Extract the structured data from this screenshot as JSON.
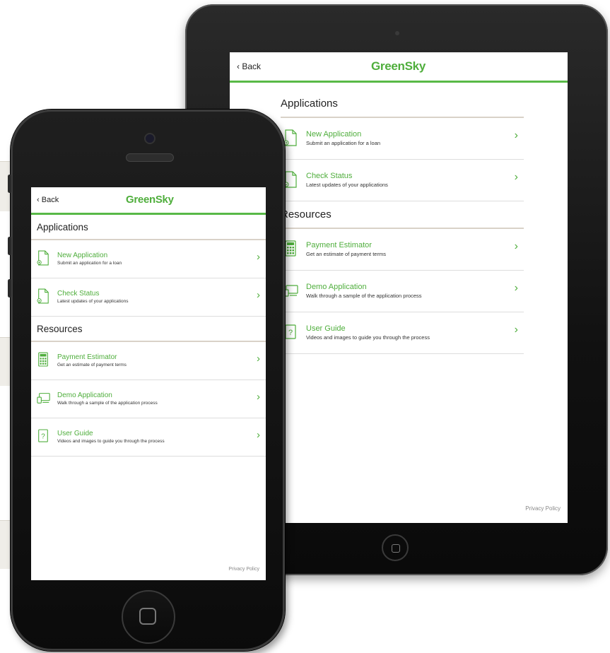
{
  "ipad": {
    "back_label": "Back",
    "logo": "GreenSky",
    "sections": [
      {
        "title": "Applications",
        "items": [
          {
            "title": "New Application",
            "subtitle": "Submit an application for a loan",
            "icon": "new-application-icon"
          },
          {
            "title": "Check Status",
            "subtitle": "Latest updates of your applications",
            "icon": "check-status-icon"
          }
        ]
      },
      {
        "title": "Resources",
        "items": [
          {
            "title": "Payment Estimator",
            "subtitle": "Get an estimate of payment terms",
            "icon": "calculator-icon"
          },
          {
            "title": "Demo Application",
            "subtitle": "Walk through a sample of the application process",
            "icon": "devices-icon"
          },
          {
            "title": "User Guide",
            "subtitle": "Videos and images to guide you through the process",
            "icon": "question-icon"
          }
        ]
      }
    ],
    "privacy": "Privacy Policy"
  },
  "iphone": {
    "back_label": "Back",
    "logo": "GreenSky",
    "sections": [
      {
        "title": "Applications",
        "items": [
          {
            "title": "New Application",
            "subtitle": "Submit an application for a loan",
            "icon": "new-application-icon"
          },
          {
            "title": "Check Status",
            "subtitle": "Latest updates of your applications",
            "icon": "check-status-icon"
          }
        ]
      },
      {
        "title": "Resources",
        "items": [
          {
            "title": "Payment Estimator",
            "subtitle": "Get an estimate of payment terms",
            "icon": "calculator-icon"
          },
          {
            "title": "Demo Application",
            "subtitle": "Walk through a sample of the application process",
            "icon": "devices-icon"
          },
          {
            "title": "User Guide",
            "subtitle": "Videos and images to guide you through the process",
            "icon": "question-icon"
          }
        ]
      }
    ],
    "privacy": "Privacy Policy"
  },
  "colors": {
    "brand_green": "#4fae3c",
    "divider_beige": "#d9d2c8",
    "device_black": "#111111"
  }
}
